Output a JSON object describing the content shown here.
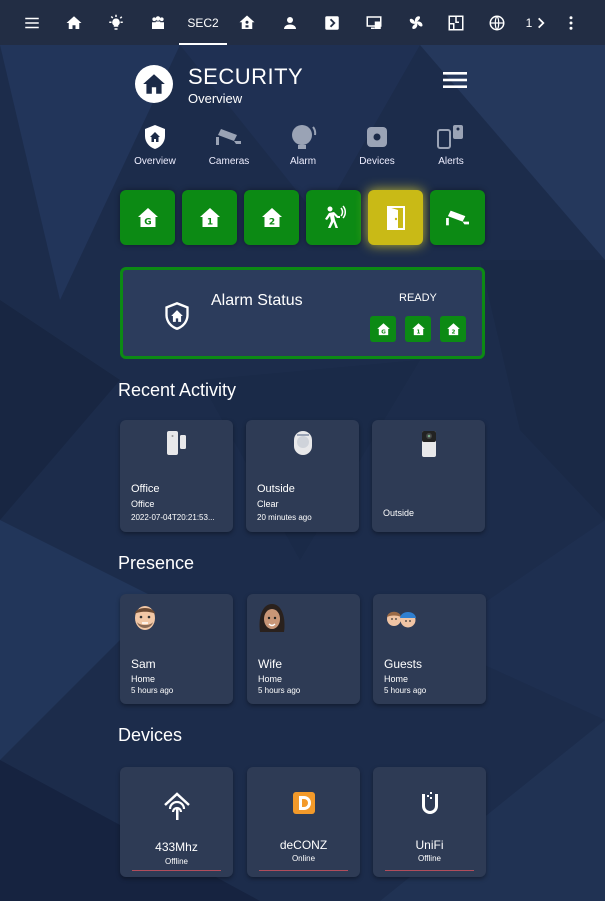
{
  "colors": {
    "accent_green": "#0c8a14",
    "accent_yellow": "#c9ba16",
    "background": "#1b2a47",
    "card": "#2e3b55",
    "topbar": "#222d44"
  },
  "topbar": {
    "items": [
      {
        "icon": "menu-icon"
      },
      {
        "icon": "home-icon"
      },
      {
        "icon": "lightbulb-icon"
      },
      {
        "icon": "group-icon"
      },
      {
        "label": "SEC2",
        "active": true
      },
      {
        "icon": "house-network-icon"
      },
      {
        "icon": "person-icon"
      },
      {
        "icon": "chevron-box-icon"
      },
      {
        "icon": "monitor-icon"
      },
      {
        "icon": "fan-icon"
      },
      {
        "icon": "floor-plan-icon"
      },
      {
        "icon": "globe-icon"
      },
      {
        "label": "1"
      },
      {
        "icon": "more-vertical-icon"
      }
    ]
  },
  "header": {
    "title": "SECURITY",
    "subtitle": "Overview"
  },
  "subnav": [
    {
      "label": "Overview",
      "icon": "shield-home-icon"
    },
    {
      "label": "Cameras",
      "icon": "cctv-icon"
    },
    {
      "label": "Alarm",
      "icon": "bell-icon"
    },
    {
      "label": "Devices",
      "icon": "device-icon"
    },
    {
      "label": "Alerts",
      "icon": "alert-devices-icon"
    }
  ],
  "modes": [
    {
      "icon": "home-g-icon",
      "state": "green"
    },
    {
      "icon": "home-1-icon",
      "state": "green"
    },
    {
      "icon": "home-2-icon",
      "state": "green"
    },
    {
      "icon": "motion-icon",
      "state": "green"
    },
    {
      "icon": "door-open-icon",
      "state": "yellow"
    },
    {
      "icon": "cctv-icon",
      "state": "green"
    }
  ],
  "alarm": {
    "title": "Alarm Status",
    "state": "READY"
  },
  "recent": {
    "title": "Recent Activity",
    "items": [
      {
        "name": "Office",
        "state": "Office",
        "time": "2022-07-04T20:21:53...",
        "icon": "door-sensor-icon"
      },
      {
        "name": "Outside",
        "state": "Clear",
        "time": "20 minutes ago",
        "icon": "motion-sensor-icon"
      },
      {
        "name": "",
        "state": "Outside",
        "time": "",
        "icon": "camera-icon"
      }
    ]
  },
  "presence": {
    "title": "Presence",
    "people": [
      {
        "name": "Sam",
        "state": "Home",
        "time": "5 hours ago"
      },
      {
        "name": "Wife",
        "state": "Home",
        "time": "5 hours ago"
      },
      {
        "name": "Guests",
        "state": "Home",
        "time": "5 hours ago"
      }
    ]
  },
  "devices": {
    "title": "Devices",
    "items": [
      {
        "name": "433Mhz",
        "state": "Offline",
        "icon": "rf-icon"
      },
      {
        "name": "deCONZ",
        "state": "Online",
        "icon": "deconz-icon"
      },
      {
        "name": "UniFi",
        "state": "Offline",
        "icon": "unifi-icon"
      }
    ]
  }
}
